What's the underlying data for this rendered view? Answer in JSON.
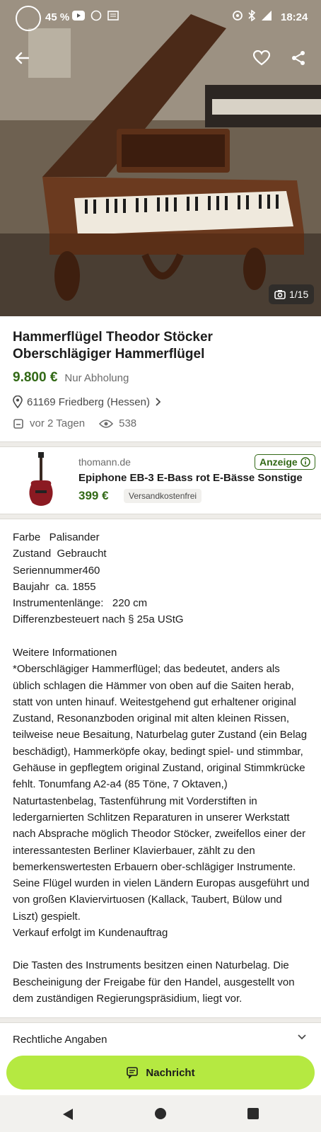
{
  "status_bar": {
    "battery": "45 %",
    "time": "18:24"
  },
  "hero": {
    "photo_counter": "1/15"
  },
  "listing": {
    "title_line1": "Hammerflügel Theodor Stöcker",
    "title_line2": "Oberschlägiger Hammerflügel",
    "price": "9.800 €",
    "pickup": "Nur Abholung",
    "location": "61169 Friedberg (Hessen)",
    "posted": "vor 2 Tagen",
    "views": "538"
  },
  "ad": {
    "shop": "thomann.de",
    "badge": "Anzeige",
    "title": "Epiphone EB-3 E-Bass rot E-Bässe Sonstige",
    "price": "399 €",
    "shipping": "Versandkostenfrei"
  },
  "attributes": [
    "Farbe   Palisander",
    "Zustand  Gebraucht",
    "Seriennummer460",
    "Baujahr  ca. 1855",
    "Instrumentenlänge:   220 cm",
    "Differenzbesteuert nach § 25a UStG"
  ],
  "description": {
    "heading": "Weitere Informationen",
    "body": "*Oberschlägiger Hammerflügel; das bedeutet, anders als üblich schlagen die Hämmer von oben auf die Saiten herab, statt von unten hinauf. Weitestgehend gut erhaltener original Zustand, Resonanzboden original mit alten kleinen Rissen, teilweise neue Besaitung, Naturbelag guter Zustand (ein Belag beschädigt), Hammerköpfe okay, bedingt spiel- und stimmbar, Gehäuse in gepflegtem original Zustand, original Stimmkrücke fehlt. Tonumfang A2-a4 (85 Töne, 7 Oktaven,) Naturtastenbelag, Tastenführung mit Vorderstiften in ledergarnierten Schlitzen Reparaturen in unserer Werkstatt nach Absprache möglich Theodor Stöcker, zweifellos einer der interessantesten Berliner Klavierbauer, zählt zu den bemerkenswertesten Erbauern ober-schlägiger Instrumente. Seine Flügel wurden in vielen Ländern Europas ausgeführt und von großen Klaviervirtuosen (Kallack, Taubert, Bülow und Liszt) gespielt.",
    "sale_note": "Verkauf erfolgt im Kundenauftrag",
    "paragraph2": "Die Tasten des Instruments besitzen einen Naturbelag. Die Bescheinigung der Freigabe für den Handel, ausgestellt von dem zuständigen Regierungspräsidium, liegt vor."
  },
  "legal": {
    "label": "Rechtliche Angaben"
  },
  "message_button": {
    "label": "Nachricht"
  },
  "colors": {
    "accent_green": "#326916",
    "button_lime": "#b5e941"
  }
}
